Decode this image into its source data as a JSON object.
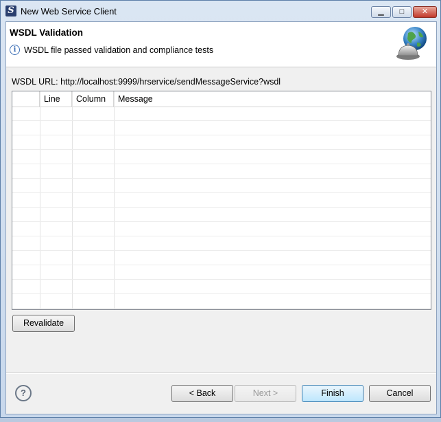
{
  "window": {
    "title": "New Web Service Client",
    "app_icon_glyph": "S",
    "minimize_glyph": "▁",
    "maximize_glyph": "□",
    "close_glyph": "✕"
  },
  "banner": {
    "title": "WSDL Validation",
    "message": "WSDL file passed validation and compliance tests",
    "info_icon": "info-icon",
    "wizard_icon": "globe-bell-icon"
  },
  "wsdl_url": "WSDL URL: http://localhost:9999/hrservice/sendMessageService?wsdl",
  "table": {
    "columns": [
      "",
      "Line",
      "Column",
      "Message"
    ],
    "rows": []
  },
  "buttons": {
    "revalidate": "Revalidate",
    "back": "< Back",
    "next": "Next >",
    "finish": "Finish",
    "cancel": "Cancel"
  },
  "help_glyph": "?",
  "colors": {
    "titlebar": "#dbe6f3",
    "close_button": "#c2392b",
    "default_button": "#bee6fd"
  }
}
